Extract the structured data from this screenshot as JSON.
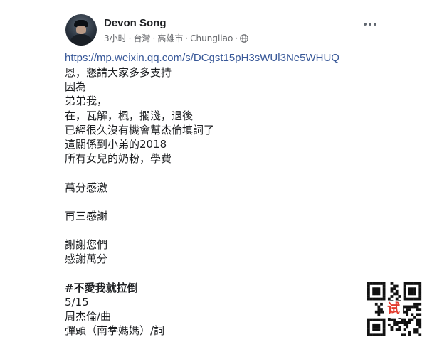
{
  "post": {
    "author": "Devon Song",
    "meta": {
      "time": "3小时",
      "region": "台灣",
      "city": "高雄市",
      "place": "Chungliao",
      "separator": "·"
    },
    "link": "https://mp.weixin.qq.com/s/DCgst15pH3sWUl3Ne5WHUQ",
    "lines_a": [
      "恩，懇請大家多多支持",
      "因為",
      "弟弟我，",
      "在，瓦解，楓，擱淺，退後",
      "已經很久沒有機會幫杰倫填詞了",
      "這關係到小弟的2018",
      "所有女兒的奶粉，學費"
    ],
    "line_b": "萬分感激",
    "line_c": "再三感謝",
    "lines_d": [
      "謝謝您們",
      "感謝萬分"
    ],
    "hashtag": "#不愛我就拉倒",
    "lines_e": [
      "5/15",
      "周杰倫/曲",
      "彈頭（南拳媽媽）/詞"
    ]
  },
  "watermark": {
    "stamp": "试"
  },
  "icons": {
    "privacy": "globe-icon",
    "more": "more-options-icon"
  }
}
